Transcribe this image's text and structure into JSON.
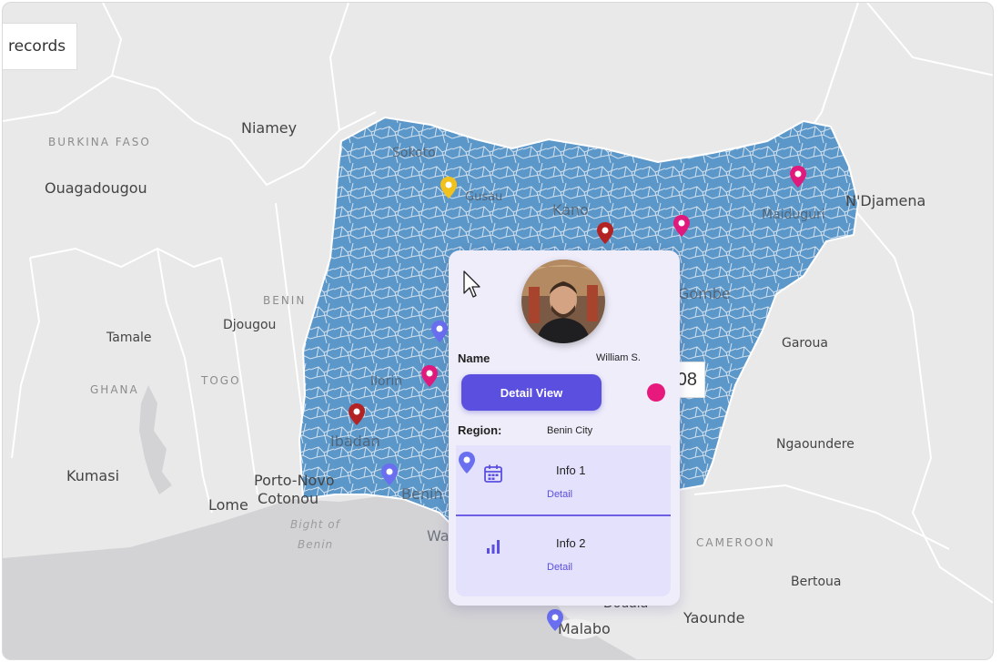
{
  "map": {
    "records_label": "records",
    "count_value": "08",
    "colors": {
      "land": "#f1f1f2",
      "water": "#d3d3d6",
      "region_fill": "#5b97c9",
      "region_line": "#d8e4ee",
      "border": "#ffffff"
    },
    "labels": {
      "niamey": "Niamey",
      "burkina_faso": "BURKINA FASO",
      "ouagadougou": "Ouagadougou",
      "sokoto": "Sokoto",
      "gusau": "Gusau",
      "kano": "Kano",
      "maiduguri": "Maiduguri",
      "ndjamena": "N'Djamena",
      "benin_country": "BENIN",
      "djougou": "Djougou",
      "tamale": "Tamale",
      "togo": "TOGO",
      "ghana": "GHANA",
      "ilorin": "Ilorin",
      "ibadan": "Ibadan",
      "kumasi": "Kumasi",
      "porto_novo": "Porto-Novo",
      "cotonou": "Cotonou",
      "lome": "Lome",
      "bight_of": "Bight of",
      "benin_water": "Benin",
      "benin_city_partial": "Benin C",
      "wa_partial": "Wa",
      "gombe": "Gombe",
      "garoua": "Garoua",
      "ngaoundere": "Ngaoundere",
      "cameroon": "CAMEROON",
      "bertoua": "Bertoua",
      "douala": "Douala",
      "malabo": "Malabo",
      "yaounde": "Yaounde"
    },
    "pin_colors": {
      "pink": "#e0197d",
      "red": "#b32323",
      "blue": "#6a6ff0",
      "yellow": "#f0c21b"
    }
  },
  "card": {
    "name_label": "Name",
    "name_value": "William S.",
    "detail_button_label": "Detail View",
    "region_label": "Region:",
    "region_value": "Benin City",
    "dot_color": "#e8197c",
    "info_items": [
      {
        "title": "Info 1",
        "link": "Detail",
        "icon": "calendar-icon"
      },
      {
        "title": "Info 2",
        "link": "Detail",
        "icon": "bar-chart-icon"
      }
    ]
  }
}
